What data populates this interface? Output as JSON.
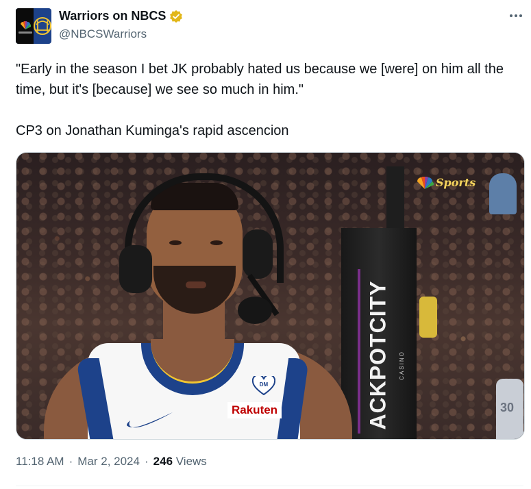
{
  "author": {
    "display_name": "Warriors on NBCS",
    "handle": "@NBCSWarriors",
    "verified": true,
    "avatar_icon": "nbc-peacock-bridge-logo"
  },
  "more_icon": "ellipsis-icon",
  "tweet": {
    "paragraph_1": "\"Early in the season I bet JK probably hated us because we [were] on him all the time, but it's [because] we see so much in him.\"",
    "paragraph_2": "CP3 on Jonathan Kuminga's rapid ascencion"
  },
  "media": {
    "type": "image",
    "watermark_text": "Sports",
    "sign_text": "ACKPOTCITY",
    "sign_subtext": "CASINO",
    "jersey_sponsor": "Rakuten",
    "jersey_badge": "DM",
    "background_jersey_number": "30"
  },
  "meta": {
    "time": "11:18 AM",
    "separator": "·",
    "date": "Mar 2, 2024",
    "views_count": "246",
    "views_label": "Views"
  },
  "colors": {
    "text_primary": "#0f1419",
    "text_secondary": "#536471",
    "verified_gold": "#e2b719",
    "warriors_blue": "#1d428a",
    "warriors_gold": "#f1c531",
    "rakuten_red": "#bf0000"
  }
}
